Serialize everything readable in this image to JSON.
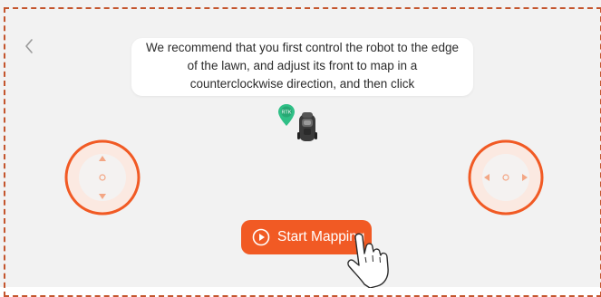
{
  "screen": {
    "instruction_lines": [
      "We recommend that you first control the robot to the edge",
      "of the lawn, and adjust its front to map in a",
      "counterclockwise direction, and then click"
    ],
    "pin_label": "RTK",
    "start_button_label": "Start Mapping"
  },
  "icons": {
    "back": "chevron-left-icon",
    "pin": "map-pin-icon",
    "robot": "robot-mower-icon",
    "play": "play-circle-icon",
    "hand": "tap-hand-icon"
  },
  "colors": {
    "accent": "#f15a24",
    "background": "#f2f2f2",
    "border": "#c4552d",
    "pin": "#2fbf86"
  }
}
